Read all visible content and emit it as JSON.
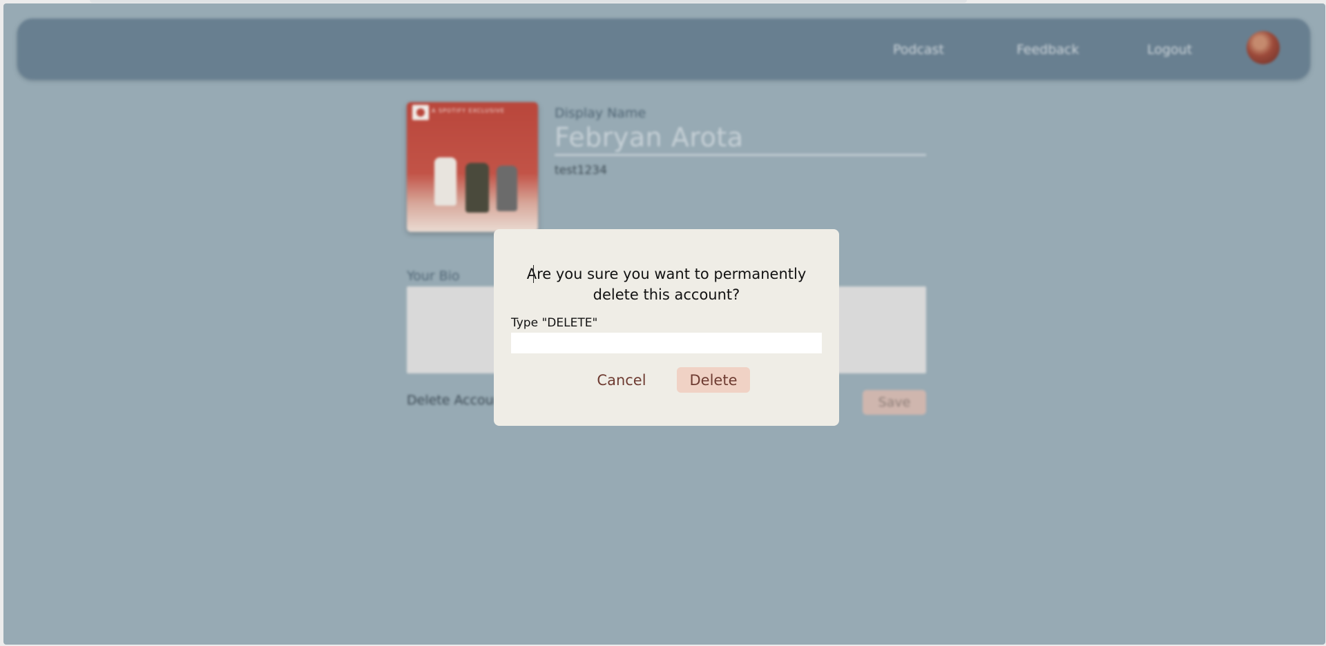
{
  "nav": {
    "links": [
      "Podcast",
      "Feedback",
      "Logout"
    ]
  },
  "profile": {
    "cover_badge_text": "A SPOTIFY EXCLUSIVE",
    "display_name_label": "Display Name",
    "display_name": "Febryan Arota",
    "username": "test1234",
    "bio_label": "Your Bio",
    "bio_value": "",
    "delete_account_label": "Delete Account",
    "save_label": "Save"
  },
  "modal": {
    "title": "Are you sure you want to permanently delete this account?",
    "type_label": "Type \"DELETE\"",
    "input_value": "",
    "cancel_label": "Cancel",
    "delete_label": "Delete"
  },
  "colors": {
    "page_bg": "#97aab4",
    "navbar_bg": "#687f90",
    "modal_bg": "#efede6",
    "accent_button": "#f0d2c5",
    "accent_text": "#6e3b31"
  }
}
